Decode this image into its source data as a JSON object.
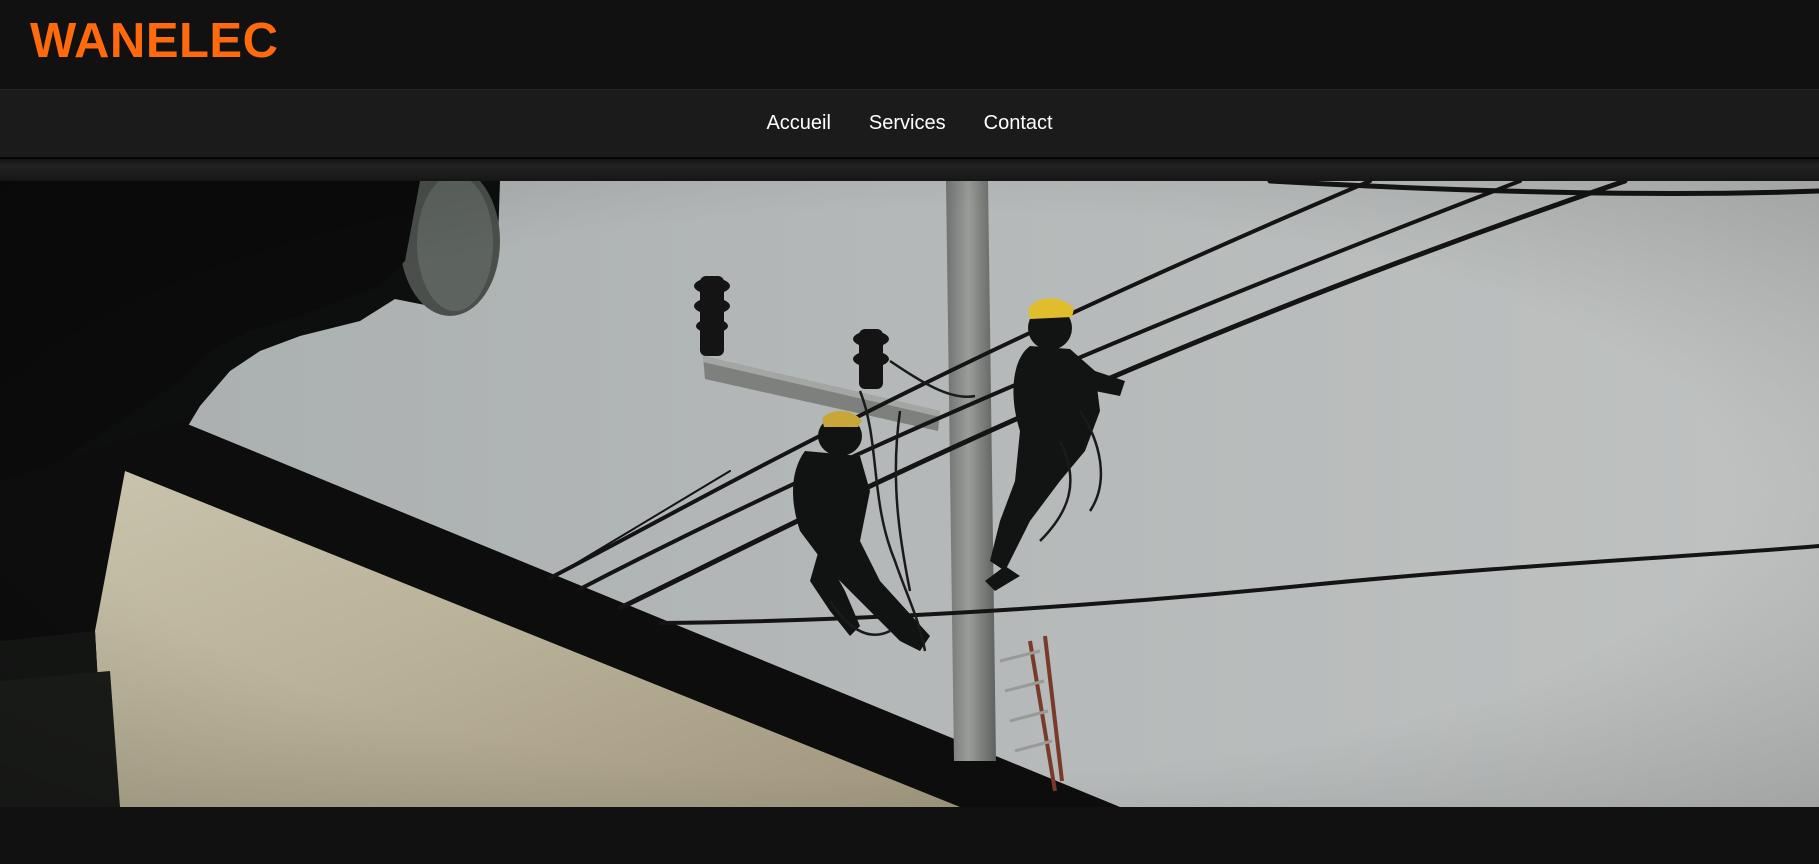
{
  "brand": {
    "name": "WANELEC",
    "color": "#ff6a0c"
  },
  "nav": {
    "items": [
      {
        "label": "Accueil"
      },
      {
        "label": "Services"
      },
      {
        "label": "Contact"
      }
    ]
  },
  "hero": {
    "icon": "photo-utility-workers-on-pole"
  },
  "colors": {
    "background": "#111111",
    "navbar": "#1b1b1b",
    "nav_text": "#ffffff"
  }
}
